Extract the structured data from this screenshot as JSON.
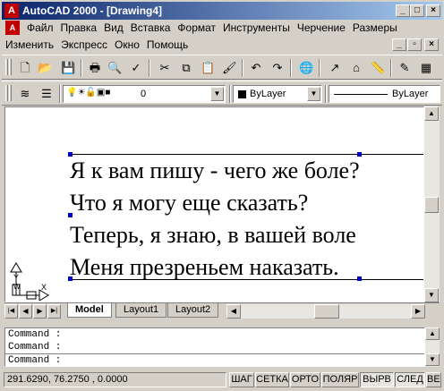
{
  "window": {
    "title": "AutoCAD 2000 - [Drawing4]",
    "app_icon_glyph": "A",
    "controls": [
      "_",
      "□",
      "×"
    ]
  },
  "menu": {
    "row1": [
      "Файл",
      "Правка",
      "Вид",
      "Вставка",
      "Формат",
      "Инструменты",
      "Черчение",
      "Размеры"
    ],
    "row2": [
      "Изменить",
      "Экспресс",
      "Окно",
      "Помощь"
    ],
    "doc_controls": [
      "_",
      "▫",
      "×"
    ]
  },
  "standard_toolbar": {
    "icons": [
      "new-icon",
      "open-icon",
      "save-icon",
      "print-icon",
      "print-preview-icon",
      "spellcheck-icon",
      "cut-icon",
      "copy-icon",
      "paste-icon",
      "match-properties-icon",
      "undo-icon",
      "redo-icon",
      "web-icon",
      "snap-from-icon",
      "ucs-icon",
      "distance-icon",
      "properties-icon",
      "adcenter-icon"
    ],
    "glyphs": [
      "🗋",
      "📂",
      "💾",
      "🖶",
      "🔍",
      "✓",
      "✂",
      "⧉",
      "📋",
      "🖌",
      "↶",
      "↷",
      "🌐",
      "↗",
      "⌂",
      "📏",
      "✎",
      "▦"
    ]
  },
  "properties_toolbar": {
    "layer_value": "0",
    "color_value": "ByLayer",
    "linetype_value": "ByLayer",
    "layer_icons": [
      "💡",
      "☀",
      "🔓",
      "▣",
      "■"
    ]
  },
  "drawing": {
    "mtext_lines": [
      "Я к вам пишу - чего же боле?",
      "Что я могу еще сказать?",
      "Теперь, я знаю, в вашей воле",
      "Меня презреньем наказать."
    ],
    "ucs": {
      "x_label": "X",
      "y_label": "Y",
      "w_label": "W"
    }
  },
  "layout_tabs": {
    "tabs": [
      "Model",
      "Layout1",
      "Layout2"
    ],
    "active": "Model",
    "nav": [
      "|◀",
      "◀",
      "▶",
      "▶|"
    ]
  },
  "command_window": {
    "lines": [
      "Command :",
      "Command :",
      "Command :"
    ]
  },
  "status_bar": {
    "coordinates": "291.6290, 76.2750 , 0.0000",
    "toggles": [
      "ШАГ",
      "СЕТКА",
      "ОРТО",
      "ПОЛЯР",
      "ВЫРВ",
      "СЛЕД",
      "ВЕС"
    ]
  }
}
